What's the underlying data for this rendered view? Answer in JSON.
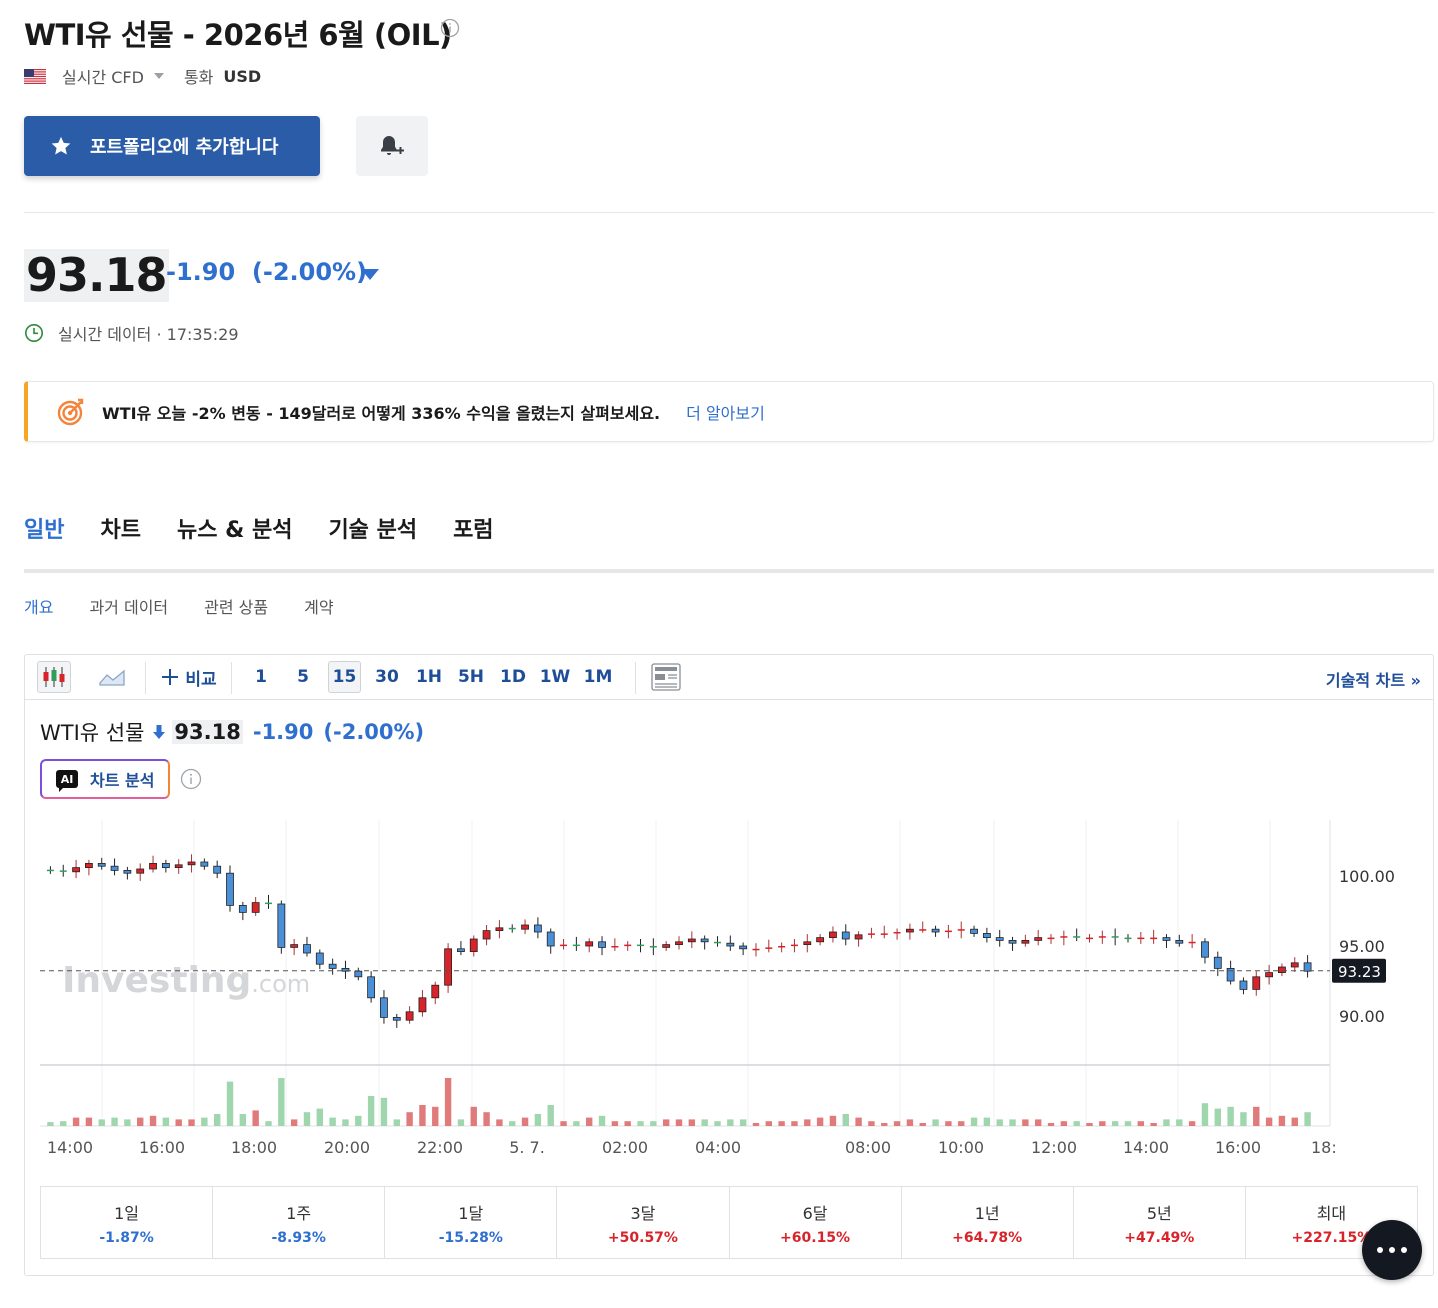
{
  "header": {
    "title": "WTI유 선물 - 2026년 6월 (OIL)",
    "market_type": "실시간 CFD",
    "currency_label": "통화",
    "currency": "USD"
  },
  "actions": {
    "portfolio_label": "포트폴리오에 추가합니다"
  },
  "quote": {
    "price": "93.18",
    "change": "-1.90",
    "change_pct": "(-2.00%)",
    "realtime_text": "실시간 데이터 · 17:35:29"
  },
  "banner": {
    "text": "WTI유 오늘 -2% 변동 - 149달러로 어떻게 336% 수익을 올렸는지 살펴보세요.",
    "link": "더 알아보기"
  },
  "tabs": [
    "일반",
    "차트",
    "뉴스 & 분석",
    "기술 분석",
    "포럼"
  ],
  "subtabs": [
    "개요",
    "과거 데이터",
    "관련 상품",
    "계약"
  ],
  "toolbar": {
    "compare": "비교",
    "intervals": [
      "1",
      "5",
      "15",
      "30",
      "1H",
      "5H",
      "1D",
      "1W",
      "1M"
    ],
    "selected_interval": "15",
    "tech_chart": "기술적 차트 »"
  },
  "chart_legend": {
    "name": "WTI유 선물",
    "price": "93.18",
    "change": "-1.90",
    "change_pct": "(-2.00%)"
  },
  "ai_button": "차트 분석",
  "watermark": {
    "main": "Investing",
    "suffix": ".com"
  },
  "chart_data": {
    "type": "candlestick",
    "y_ticks": [
      "100.00",
      "95.00",
      "90.00"
    ],
    "ylim": [
      86.5,
      104.0
    ],
    "last_price_label": "93.23",
    "last_price": 93.23,
    "x_tick_labels": [
      "14:00",
      "16:00",
      "18:00",
      "20:00",
      "22:00",
      "5. 7.",
      "02:00",
      "04:00",
      "08:00",
      "10:00",
      "12:00",
      "14:00",
      "16:00",
      "18:"
    ],
    "closes": [
      100.4,
      100.3,
      100.6,
      100.9,
      100.7,
      100.4,
      100.2,
      100.5,
      100.9,
      100.6,
      100.8,
      101.0,
      100.7,
      100.2,
      97.9,
      97.4,
      98.1,
      98.0,
      94.9,
      95.1,
      94.5,
      93.7,
      93.4,
      93.2,
      92.8,
      91.3,
      89.9,
      89.7,
      90.3,
      91.3,
      92.2,
      94.8,
      94.6,
      95.5,
      96.1,
      96.3,
      96.2,
      96.5,
      96.0,
      95.0,
      95.1,
      95.0,
      95.3,
      94.9,
      95.0,
      95.1,
      95.0,
      94.9,
      95.1,
      95.3,
      95.5,
      95.3,
      95.2,
      95.0,
      94.8,
      94.8,
      94.9,
      95.0,
      95.1,
      95.3,
      95.6,
      96.0,
      95.5,
      95.8,
      95.9,
      95.9,
      96.0,
      96.2,
      96.2,
      96.0,
      96.1,
      96.2,
      95.9,
      95.6,
      95.4,
      95.2,
      95.4,
      95.6,
      95.6,
      95.7,
      95.6,
      95.6,
      95.7,
      95.6,
      95.5,
      95.6,
      95.6,
      95.4,
      95.2,
      95.3,
      94.2,
      93.4,
      92.5,
      91.9,
      92.8,
      93.1,
      93.5,
      93.8,
      93.2
    ],
    "volume_scale": "relative",
    "periods": [
      {
        "label": "1일",
        "value": "-1.87%"
      },
      {
        "label": "1주",
        "value": "-8.93%"
      },
      {
        "label": "1달",
        "value": "-15.28%"
      },
      {
        "label": "3달",
        "value": "+50.57%"
      },
      {
        "label": "6달",
        "value": "+60.15%"
      },
      {
        "label": "1년",
        "value": "+64.78%"
      },
      {
        "label": "5년",
        "value": "+47.49%"
      },
      {
        "label": "최대",
        "value": "+227.15%"
      }
    ]
  },
  "colors": {
    "accent": "#2e6fd0",
    "primary_button": "#2b5ca8",
    "up_candle": "#d8232a",
    "down_candle": "#4a90d9",
    "volume_up": "#e17b7b",
    "volume_down": "#9fd6ae",
    "banner_accent": "#f6a623"
  }
}
